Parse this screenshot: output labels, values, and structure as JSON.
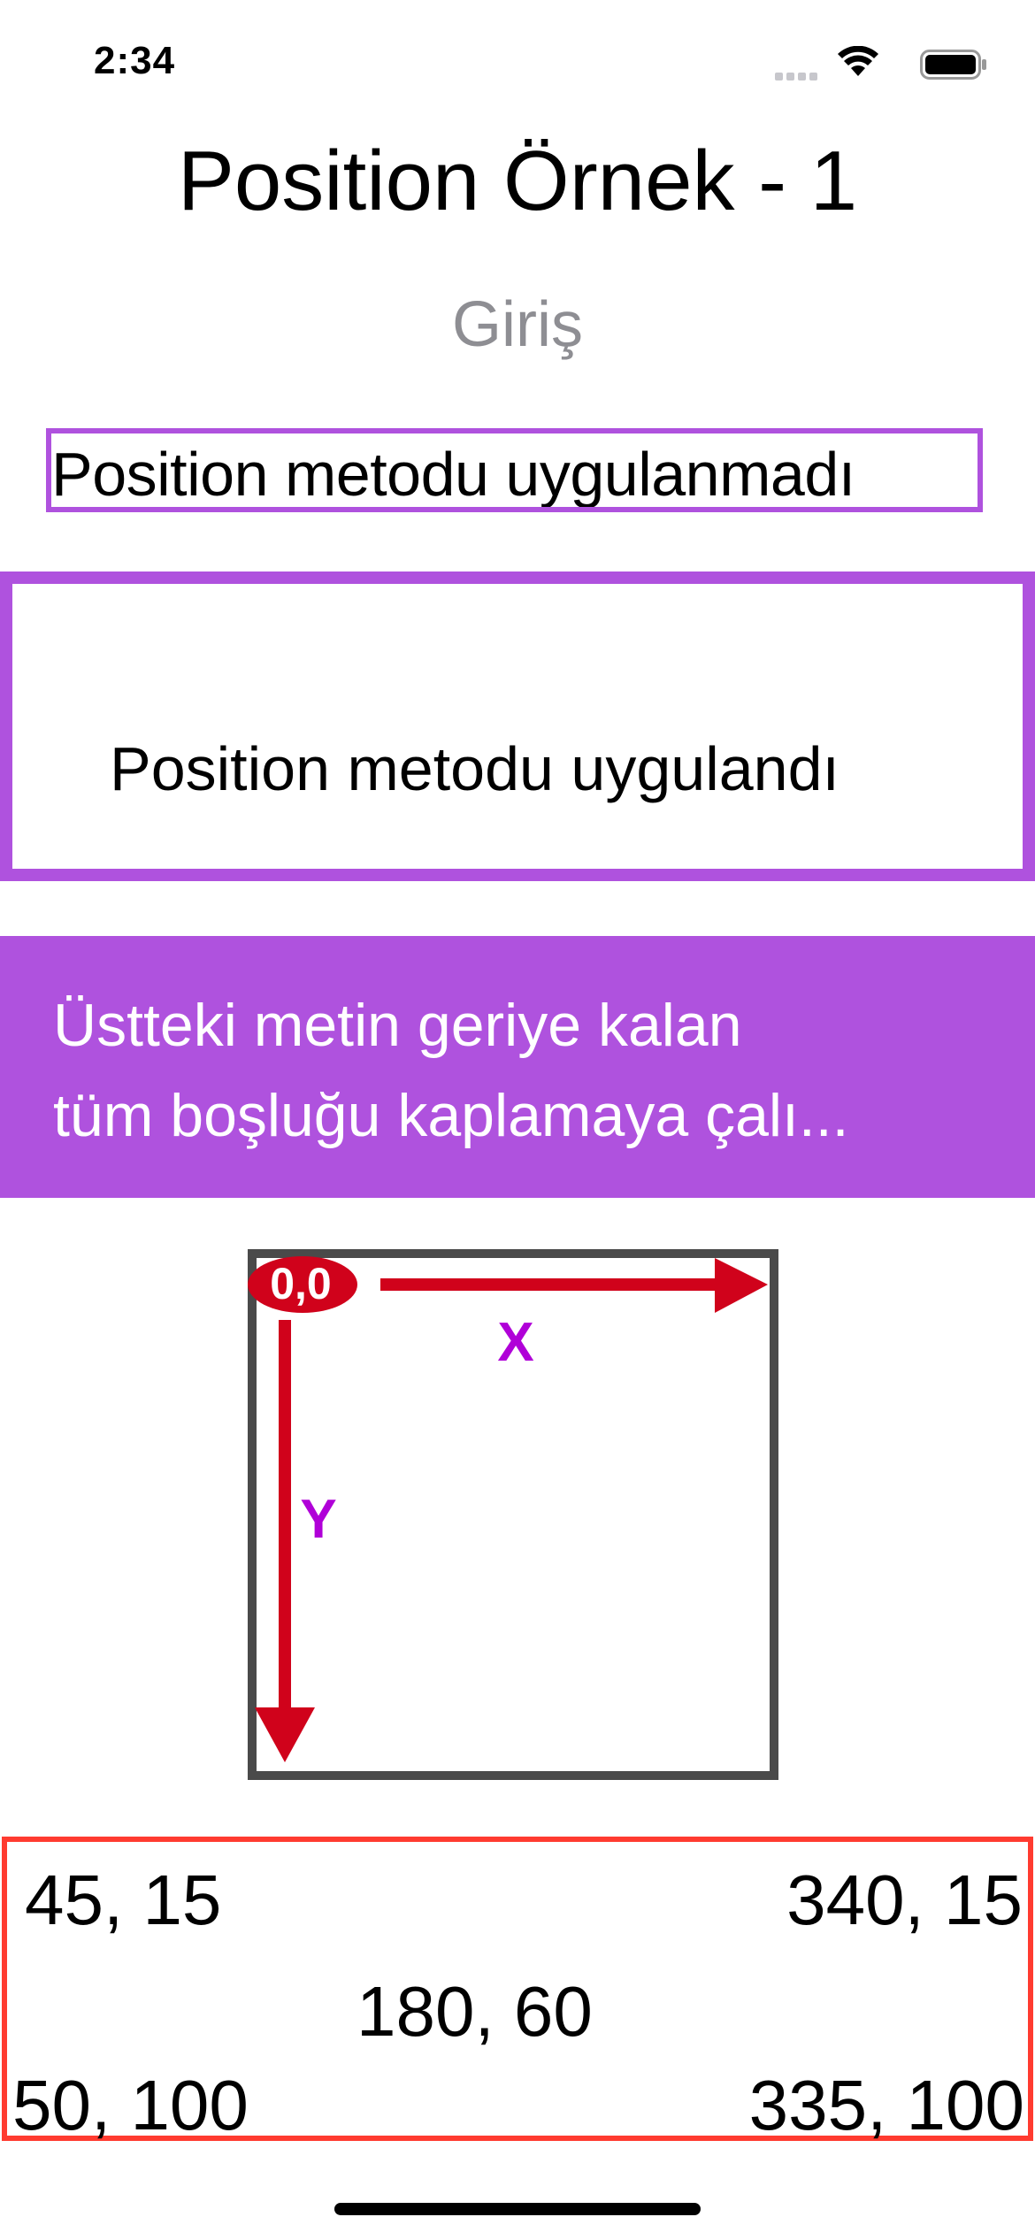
{
  "status_bar": {
    "time": "2:34",
    "icons": [
      "cellular-signal-icon",
      "wifi-icon",
      "battery-icon"
    ]
  },
  "header": {
    "title": "Position Örnek - 1",
    "subtitle": "Giriş"
  },
  "examples": {
    "not_applied_text": "Position metodu uygulanmadı",
    "applied_text": "Position metodu uygulandı",
    "fill_text_line1": "Üstteki metin geriye kalan",
    "fill_text_line2": "tüm boşluğu kaplamaya çalı..."
  },
  "diagram": {
    "origin_label": "0,0",
    "x_label": "X",
    "y_label": "Y"
  },
  "coordinates": {
    "top_left": "45, 15",
    "top_right": "340, 15",
    "center": "180, 60",
    "bottom_left": "50, 100",
    "bottom_right": "335, 100"
  },
  "colors": {
    "accent_purple": "#af52de",
    "coords_border": "#ff3b30",
    "arrow_red": "#d0021b",
    "axis_label_magenta": "#b000d8",
    "frame_gray": "#4a4a4a",
    "subtitle_gray": "#8e8e93"
  }
}
